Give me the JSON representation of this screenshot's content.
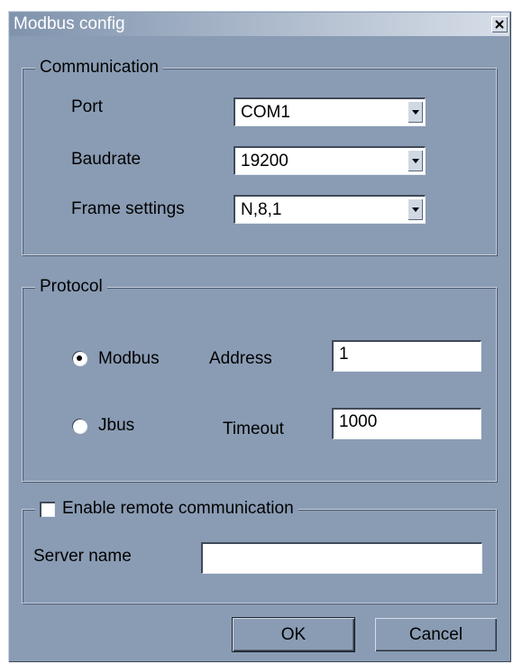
{
  "window": {
    "title": "Modbus config",
    "close_glyph": "x"
  },
  "communication": {
    "legend": "Communication",
    "port_label": "Port",
    "port_value": "COM1",
    "baudrate_label": "Baudrate",
    "baudrate_value": "19200",
    "frame_label": "Frame settings",
    "frame_value": "N,8,1"
  },
  "protocol": {
    "legend": "Protocol",
    "modbus_label": "Modbus",
    "modbus_selected": true,
    "jbus_label": "Jbus",
    "jbus_selected": false,
    "address_label": "Address",
    "address_value": "1",
    "timeout_label": "Timeout",
    "timeout_value": "1000"
  },
  "remote": {
    "enable_label": "Enable remote communication",
    "enabled": false,
    "server_label": "Server name",
    "server_value": ""
  },
  "buttons": {
    "ok": "OK",
    "cancel": "Cancel"
  },
  "colors": {
    "dialog_bg": "#8a9cb4",
    "title_text": "#ffffff"
  }
}
